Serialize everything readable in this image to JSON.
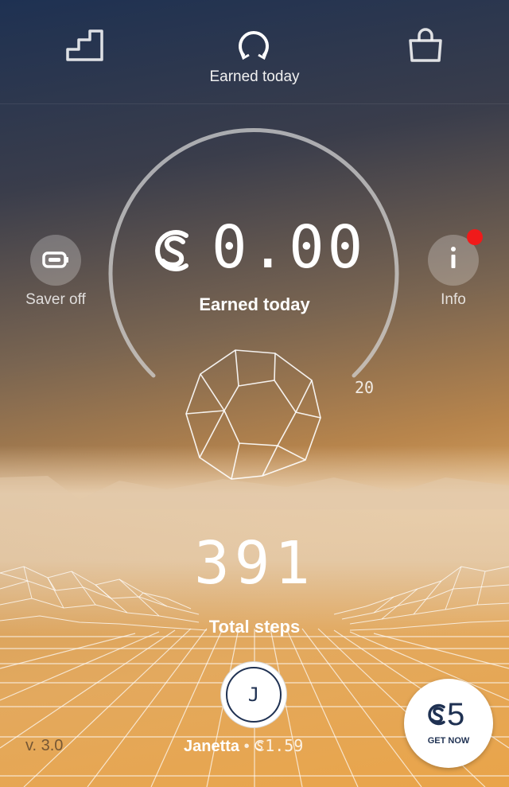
{
  "header": {
    "title": "Earned today",
    "icons": [
      "stairs-icon",
      "refresh-icon",
      "shopping-bag-icon"
    ]
  },
  "saver": {
    "icon": "battery-icon",
    "label": "Saver off"
  },
  "info": {
    "icon": "info-icon",
    "label": "Info",
    "has_notification": true,
    "badge_color": "#f01a1a"
  },
  "earnings": {
    "amount": "0.00",
    "currency_icon": "sweatcoin-icon",
    "label": "Earned today",
    "gauge_max": "20",
    "gauge_progress": 0
  },
  "steps": {
    "count": "391",
    "label": "Total steps"
  },
  "user": {
    "initial": "J",
    "name": "Janetta",
    "separator": "•",
    "balance": "1.59"
  },
  "version": "v. 3.0",
  "promo": {
    "value": "5",
    "label": "GET NOW"
  },
  "colors": {
    "accent_navy": "#1f3152",
    "warm_orange": "#e9a449"
  }
}
